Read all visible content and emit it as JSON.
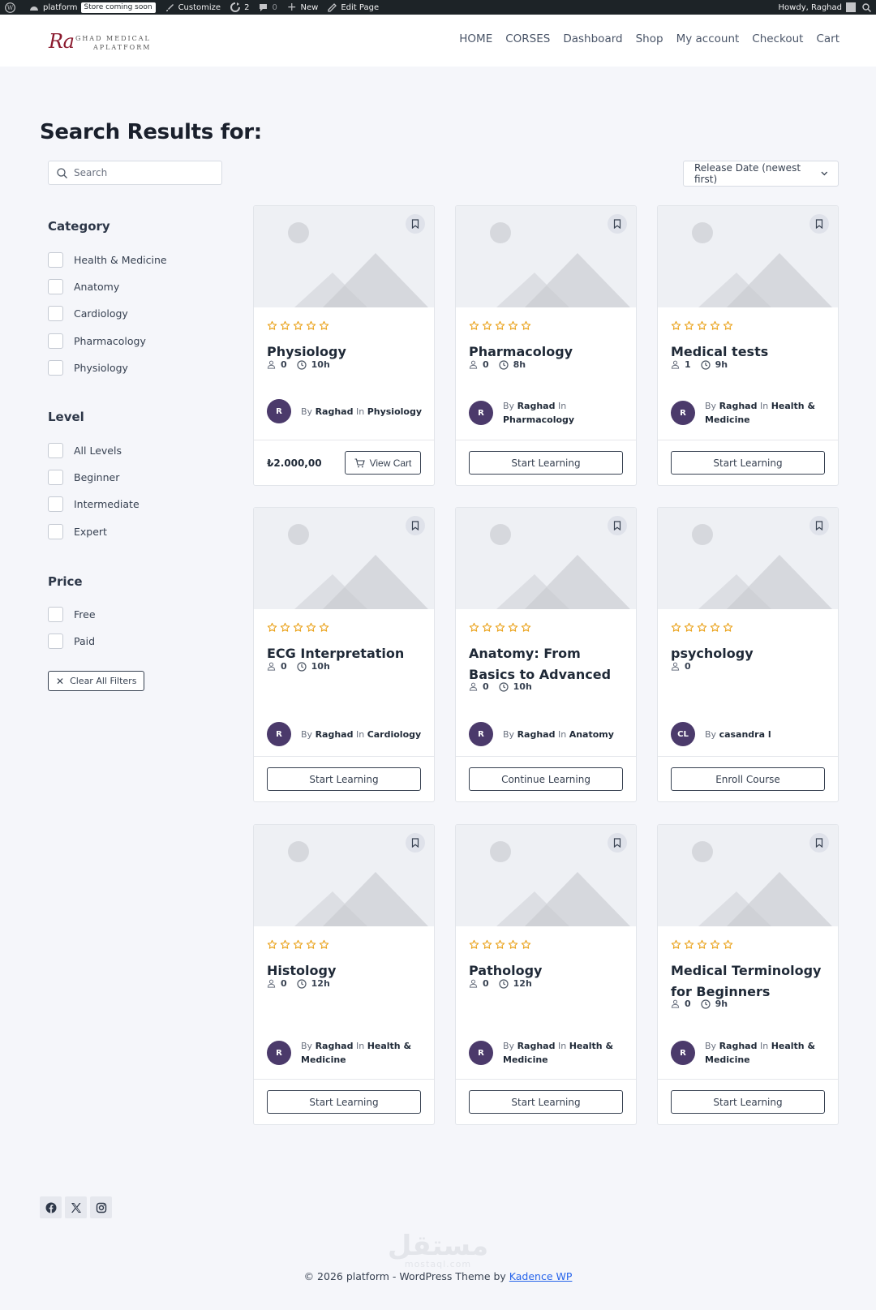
{
  "admin_bar": {
    "site": "platform",
    "store_badge": "Store coming soon",
    "customize": "Customize",
    "updates": "2",
    "comments": "0",
    "new": "New",
    "edit_page": "Edit Page",
    "howdy": "Howdy, Raghad"
  },
  "header": {
    "logo_script": "Ra",
    "logo_line1": "GHAD MEDICAL",
    "logo_line2": "APLATFORM",
    "nav": [
      "HOME",
      "CORSES",
      "Dashboard",
      "Shop",
      "My account",
      "Checkout",
      "Cart"
    ]
  },
  "page": {
    "title": "Search Results for:",
    "search_placeholder": "Search",
    "sort_label": "Release Date (newest first)"
  },
  "filters": {
    "category_title": "Category",
    "categories": [
      "Health & Medicine",
      "Anatomy",
      "Cardiology",
      "Pharmacology",
      "Physiology"
    ],
    "level_title": "Level",
    "levels": [
      "All Levels",
      "Beginner",
      "Intermediate",
      "Expert"
    ],
    "price_title": "Price",
    "prices": [
      "Free",
      "Paid"
    ],
    "clear_label": "Clear All Filters"
  },
  "courses": [
    {
      "title": "Physiology",
      "students": "0",
      "duration": "10h",
      "author_initials": "R",
      "by": "By",
      "author": "Raghad",
      "in": "In",
      "category": "Physiology",
      "price": "₺2.000,00",
      "action": "View Cart"
    },
    {
      "title": "Pharmacology",
      "students": "0",
      "duration": "8h",
      "author_initials": "R",
      "by": "By",
      "author": "Raghad",
      "in": "In",
      "category": "Pharmacology",
      "action": "Start Learning"
    },
    {
      "title": "Medical tests",
      "students": "1",
      "duration": "9h",
      "author_initials": "R",
      "by": "By",
      "author": "Raghad",
      "in": "In",
      "category": "Health & Medicine",
      "action": "Start Learning"
    },
    {
      "title": "ECG Interpretation",
      "students": "0",
      "duration": "10h",
      "author_initials": "R",
      "by": "By",
      "author": "Raghad",
      "in": "In",
      "category": "Cardiology",
      "action": "Start Learning"
    },
    {
      "title": "Anatomy: From Basics to Advanced",
      "students": "0",
      "duration": "10h",
      "author_initials": "R",
      "by": "By",
      "author": "Raghad",
      "in": "In",
      "category": "Anatomy",
      "action": "Continue Learning"
    },
    {
      "title": "psychology",
      "students": "0",
      "author_initials": "CL",
      "by": "By",
      "author": "casandra l",
      "action": "Enroll Course"
    },
    {
      "title": "Histology",
      "students": "0",
      "duration": "12h",
      "author_initials": "R",
      "by": "By",
      "author": "Raghad",
      "in": "In",
      "category": "Health & Medicine",
      "action": "Start Learning"
    },
    {
      "title": "Pathology",
      "students": "0",
      "duration": "12h",
      "author_initials": "R",
      "by": "By",
      "author": "Raghad",
      "in": "In",
      "category": "Health & Medicine",
      "action": "Start Learning"
    },
    {
      "title": "Medical Terminology for Beginners",
      "students": "0",
      "duration": "9h",
      "author_initials": "R",
      "by": "By",
      "author": "Raghad",
      "in": "In",
      "category": "Health & Medicine",
      "action": "Start Learning"
    }
  ],
  "footer": {
    "watermark": "مستقل",
    "watermark_sub": "mostaql.com",
    "copyright": "© 2026 platform - WordPress Theme by ",
    "theme_link": "Kadence WP",
    "socials": [
      "facebook-icon",
      "x-icon",
      "instagram-icon"
    ]
  },
  "colors": {
    "star": "#eaa21b",
    "avatar": "#4b3a6b",
    "link": "#2563eb"
  }
}
